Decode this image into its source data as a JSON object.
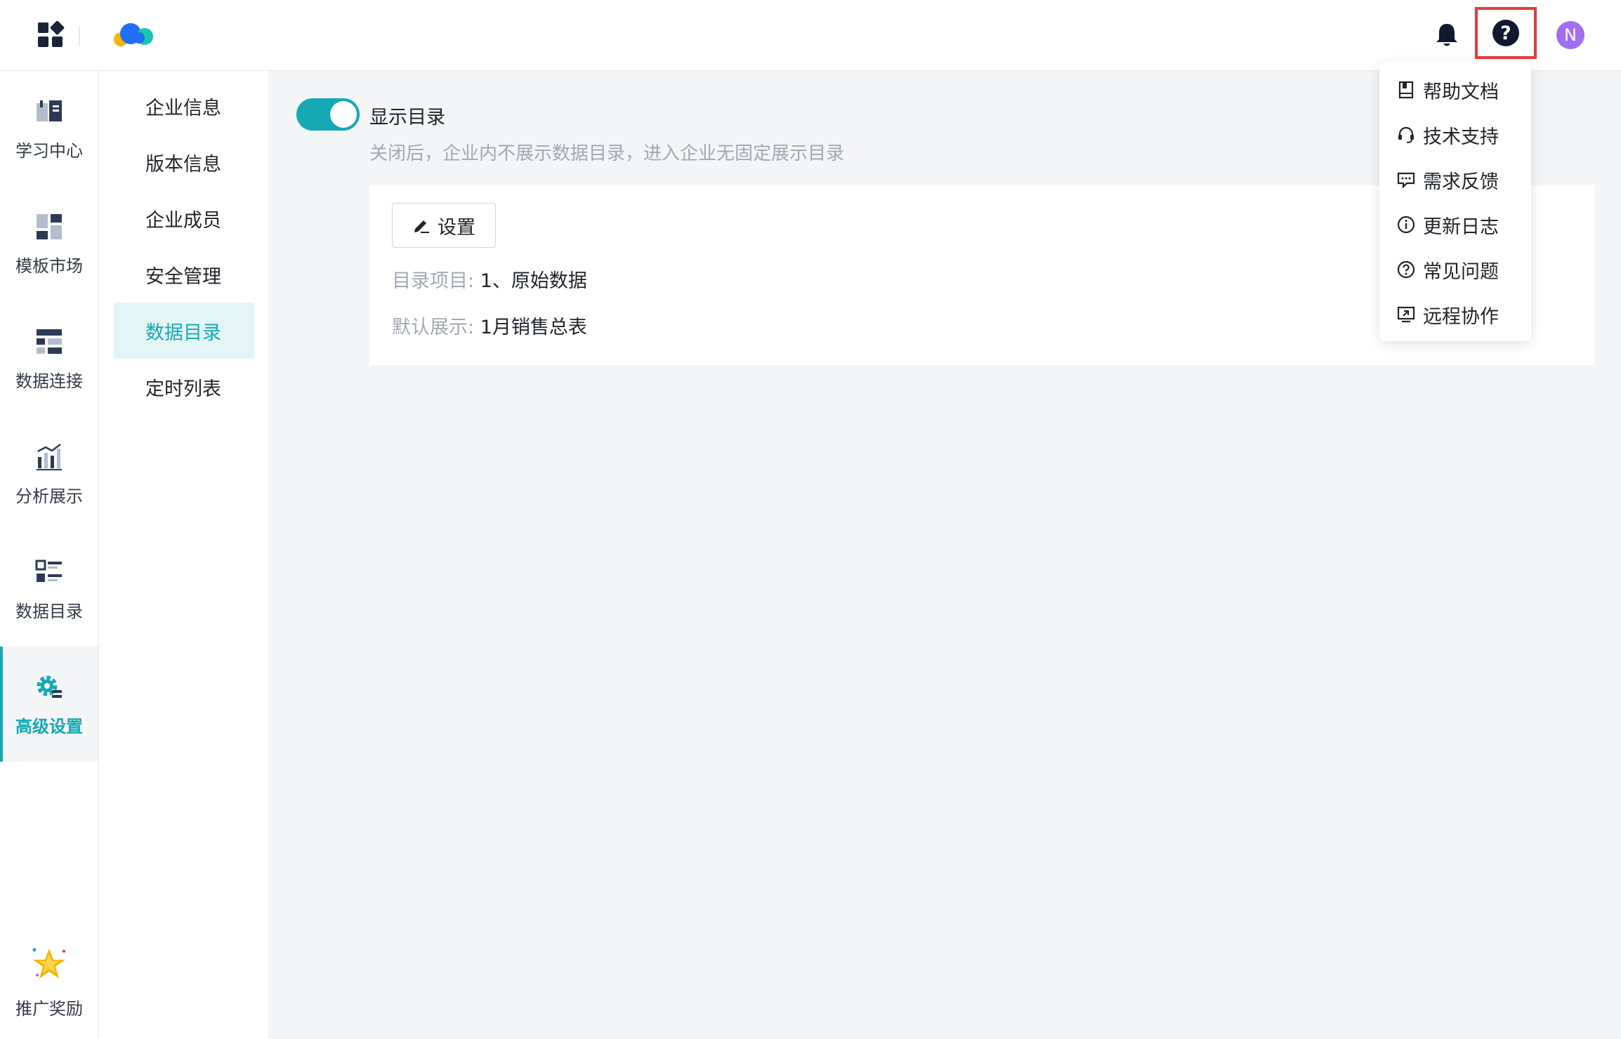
{
  "topbar": {
    "icons": [
      "apps-icon",
      "logo",
      "bell-icon",
      "help-icon"
    ],
    "avatar_letter": "N"
  },
  "rail": {
    "items": [
      {
        "label": "学习中心",
        "icon": "book-icon"
      },
      {
        "label": "模板市场",
        "icon": "template-icon"
      },
      {
        "label": "数据连接",
        "icon": "data-connect-icon"
      },
      {
        "label": "分析展示",
        "icon": "chart-icon"
      },
      {
        "label": "数据目录",
        "icon": "catalog-icon"
      },
      {
        "label": "高级设置",
        "icon": "gear-icon",
        "active": true
      },
      {
        "label": "推广奖励",
        "icon": "star-icon"
      }
    ]
  },
  "subnav": {
    "items": [
      {
        "label": "企业信息"
      },
      {
        "label": "版本信息"
      },
      {
        "label": "企业成员"
      },
      {
        "label": "安全管理"
      },
      {
        "label": "数据目录",
        "active": true
      },
      {
        "label": "定时列表"
      }
    ]
  },
  "main": {
    "toggle_label": "显示目录",
    "toggle_on": true,
    "toggle_hint": "关闭后，企业内不展示数据目录，进入企业无固定展示目录",
    "settings_label": "设置",
    "catalog_key": "目录项目:",
    "catalog_value": "1、原始数据",
    "default_key": "默认展示:",
    "default_value": "1月销售总表"
  },
  "dropdown": {
    "items": [
      {
        "label": "帮助文档",
        "icon": "doc-icon"
      },
      {
        "label": "技术支持",
        "icon": "headset-icon"
      },
      {
        "label": "需求反馈",
        "icon": "feedback-icon"
      },
      {
        "label": "更新日志",
        "icon": "info-icon"
      },
      {
        "label": "常见问题",
        "icon": "question-icon"
      },
      {
        "label": "远程协作",
        "icon": "remote-icon"
      }
    ]
  },
  "colors": {
    "accent": "#14a9b4",
    "highlight_border": "#e63a3a",
    "avatar": "#a16ef0"
  }
}
